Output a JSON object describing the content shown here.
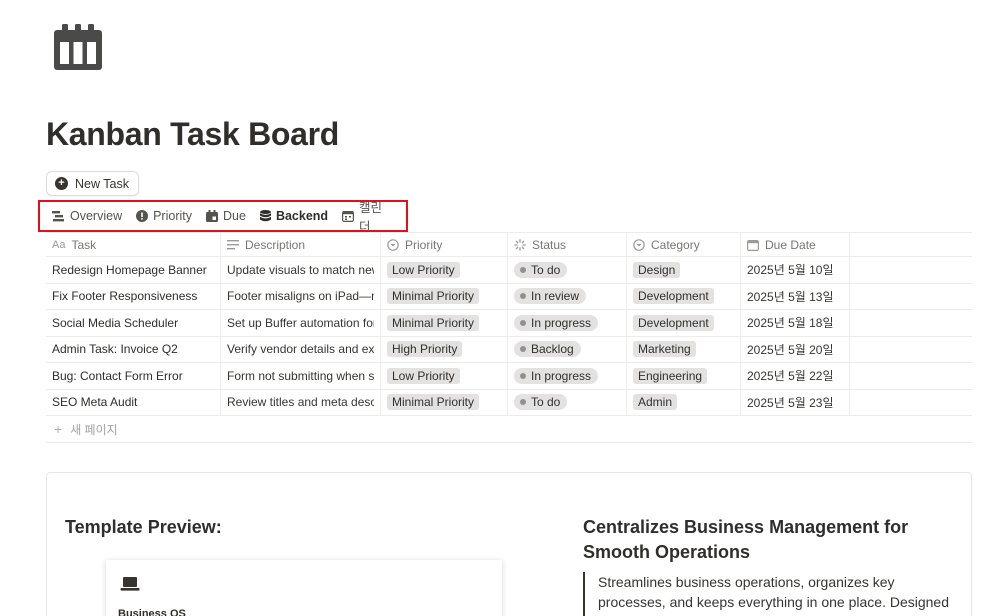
{
  "page": {
    "title": "Kanban Task Board",
    "icon": "calendar-icon"
  },
  "toolbar": {
    "new_task_label": "New Task"
  },
  "views": [
    {
      "label": "Overview",
      "icon": "board-icon"
    },
    {
      "label": "Priority",
      "icon": "alert-icon"
    },
    {
      "label": "Due",
      "icon": "calendar-check-icon"
    },
    {
      "label": "Backend",
      "icon": "database-icon",
      "active": true
    },
    {
      "label": "캘린더",
      "icon": "calendar-icon"
    }
  ],
  "table": {
    "headers": {
      "task": "Task",
      "description": "Description",
      "priority": "Priority",
      "status": "Status",
      "category": "Category",
      "due_date": "Due Date"
    },
    "rows": [
      {
        "task": "Redesign Homepage Banner",
        "description": "Update visuals to match new",
        "priority": "Low Priority",
        "status": "To do",
        "category": "Design",
        "due": "2025년 5월 10일"
      },
      {
        "task": "Fix Footer Responsiveness",
        "description": "Footer misaligns on iPad—nee",
        "priority": "Minimal Priority",
        "status": "In review",
        "category": "Development",
        "due": "2025년 5월 13일"
      },
      {
        "task": "Social Media Scheduler",
        "description": "Set up Buffer automation for I",
        "priority": "Minimal Priority",
        "status": "In progress",
        "category": "Development",
        "due": "2025년 5월 18일"
      },
      {
        "task": "Admin Task: Invoice Q2",
        "description": "Verify vendor details and expo",
        "priority": "High Priority",
        "status": "Backlog",
        "category": "Marketing",
        "due": "2025년 5월 20일"
      },
      {
        "task": "Bug: Contact Form Error",
        "description": "Form not submitting when spe",
        "priority": "Low Priority",
        "status": "In progress",
        "category": "Engineering",
        "due": "2025년 5월 22일"
      },
      {
        "task": "SEO Meta Audit",
        "description": "Review titles and meta descri",
        "priority": "Minimal Priority",
        "status": "To do",
        "category": "Admin",
        "due": "2025년 5월 23일"
      }
    ],
    "new_page_label": "새 페이지"
  },
  "preview": {
    "title": "Template Preview:",
    "mini_card_label": "Business OS",
    "heading": "Centralizes Business Management for Smooth Operations",
    "quote": "Streamlines business operations, organizes key processes, and keeps everything in one place. Designed to track"
  },
  "colors": {
    "highlight_border": "#e0101c",
    "tag_bg": "#e3e2e0",
    "text": "#37352f"
  }
}
